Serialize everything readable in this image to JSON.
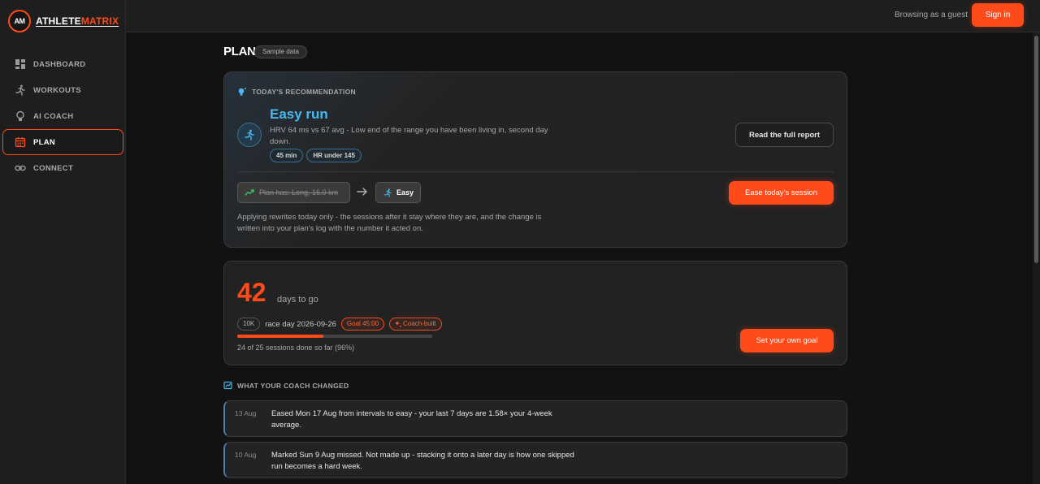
{
  "brand": {
    "logo": "AM",
    "name_a": "ATHLETE",
    "name_b": "MATRIX",
    "accent": "#ff4a1a"
  },
  "nav": {
    "items": [
      {
        "label": "DASHBOARD",
        "icon": "dashboard-icon"
      },
      {
        "label": "WORKOUTS",
        "icon": "runner-icon"
      },
      {
        "label": "AI COACH",
        "icon": "lightbulb-icon"
      },
      {
        "label": "PLAN",
        "icon": "calendar-icon",
        "active": true
      },
      {
        "label": "CONNECT",
        "icon": "link-icon"
      }
    ]
  },
  "topbar": {
    "guest_text": "Browsing as a guest",
    "signin_label": "Sign in"
  },
  "page": {
    "title": "PLAN",
    "badge": "Sample data"
  },
  "recommendation": {
    "header": "TODAY'S RECOMMENDATION",
    "title": "Easy run",
    "description": "HRV 64 ms vs 67 avg - Low end of the range you have been living in, second day down.",
    "chips": [
      "45 min",
      "HR under 145"
    ],
    "report_button": "Read the full report",
    "from_text": "Plan has: Long, 16.0 km",
    "to_text": "Easy",
    "ease_button": "Ease today's session",
    "note": "Applying rewrites today only - the sessions after it stay where they are, and the change is written into your plan's log with the number it acted on."
  },
  "race": {
    "days": "42",
    "days_label": "days to go",
    "distance": "10K",
    "race_day": "race day 2026-09-26",
    "goal": "Goal 45:00",
    "coach_built": "Coach-built",
    "sessions_text": "24 of 25 sessions done so far (96%)",
    "progress_fraction": 0.44,
    "goal_button": "Set your own goal"
  },
  "changes": {
    "header": "WHAT YOUR COACH CHANGED",
    "items": [
      {
        "date": "13 Aug",
        "text": "Eased Mon 17 Aug from intervals to easy - your last 7 days are 1.58× your 4-week average."
      },
      {
        "date": "10 Aug",
        "text": "Marked Sun 9 Aug missed. Not made up - stacking it onto a later day is how one skipped run becomes a hard week."
      }
    ]
  }
}
